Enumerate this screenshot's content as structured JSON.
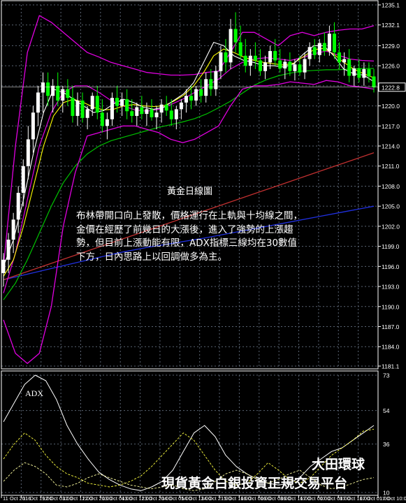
{
  "annotation": {
    "title": "黃金日線圖",
    "lines": [
      "布林帶開口向上發散，價格運行在上軌與十均線之間，",
      "金價在經歷了前幾日的大漲後，進入了強勢的上漲趨",
      "勢，但目前上漲動能有限，ADX指標三線均在30數值",
      "下方，日內思路上以回調做多為主。"
    ]
  },
  "branding": {
    "line1": "大田環球",
    "line2": "現貨黃金白銀投資正規交易平台"
  },
  "colors": {
    "background": "#000000",
    "axis": "#ffffff",
    "grid": "#5a6473",
    "bull_candle": "#ffffff",
    "bear_candle": "#00ff00",
    "bollinger": "#e000e0",
    "ma_fast": "#ffffff",
    "ma_yellow": "#ffff00",
    "ma_green": "#00c000",
    "ma_red": "#c03030",
    "ma_blue": "#2030e0",
    "price_marker": "#ffffff"
  },
  "chart_data": [
    {
      "type": "candlestick",
      "yaxis_side": "right",
      "ylim": [
        1181.1,
        1235.1
      ],
      "yticks": [
        1235.1,
        1232.1,
        1229.0,
        1226.0,
        1223.0,
        1220.0,
        1217.0,
        1214.0,
        1211.0,
        1208.0,
        1205.0,
        1202.0,
        1199.0,
        1196.0,
        1193.0,
        1190.0,
        1187.0,
        1184.0,
        1181.1
      ],
      "ytick_labels": [
        "1235.1",
        "1232.1",
        "1229.0",
        "1226.0",
        "1223.0",
        "1220.0",
        "1217.0",
        "1214.0",
        "1211.0",
        "1208.0",
        "1205.0",
        "1202.0",
        "1199.0",
        "1196.0",
        "1193.0",
        "1190.0",
        "1187.0",
        "1184.0",
        "1181.1"
      ],
      "current_price": 1222.8,
      "current_price_label": "1222.8",
      "xtick_labels": [
        "11 Oct 2016",
        "11 Oct 19:00",
        "12 Oct 03:00",
        "12 Oct 12:00",
        "12 Oct 20:00",
        "13 Oct 04:00",
        "13 Oct 12:00",
        "13 Oct 20:00",
        "14 Oct 05:00",
        "14 Oct 13:00",
        "14 Oct 21:00",
        "15 Oct 16:00",
        "16 Oct 00:00",
        "16 Oct 08:00",
        "16 Oct 16:00",
        "17 Oct 00:00",
        "17 Oct 08:00",
        "17 Oct 16:00",
        "17 Oct 01:00",
        "17 Oct 10:00"
      ],
      "candles": [
        {
          "o": 1195.0,
          "h": 1198.0,
          "l": 1193.0,
          "c": 1197.0
        },
        {
          "o": 1197.0,
          "h": 1201.0,
          "l": 1195.0,
          "c": 1200.0
        },
        {
          "o": 1200.0,
          "h": 1204.0,
          "l": 1198.0,
          "c": 1203.0
        },
        {
          "o": 1203.0,
          "h": 1208.0,
          "l": 1201.0,
          "c": 1207.0
        },
        {
          "o": 1207.0,
          "h": 1212.0,
          "l": 1205.0,
          "c": 1211.0
        },
        {
          "o": 1211.0,
          "h": 1217.0,
          "l": 1209.0,
          "c": 1215.0
        },
        {
          "o": 1215.0,
          "h": 1220.0,
          "l": 1213.0,
          "c": 1219.0
        },
        {
          "o": 1219.0,
          "h": 1223.0,
          "l": 1217.0,
          "c": 1222.0
        },
        {
          "o": 1222.0,
          "h": 1225.0,
          "l": 1219.0,
          "c": 1223.5
        },
        {
          "o": 1223.5,
          "h": 1225.0,
          "l": 1220.0,
          "c": 1221.5
        },
        {
          "o": 1221.5,
          "h": 1224.0,
          "l": 1219.0,
          "c": 1223.0
        },
        {
          "o": 1223.0,
          "h": 1225.0,
          "l": 1220.0,
          "c": 1220.8
        },
        {
          "o": 1220.8,
          "h": 1223.0,
          "l": 1219.0,
          "c": 1222.5
        },
        {
          "o": 1222.5,
          "h": 1224.0,
          "l": 1220.0,
          "c": 1221.2
        },
        {
          "o": 1221.2,
          "h": 1223.0,
          "l": 1217.5,
          "c": 1218.5
        },
        {
          "o": 1218.5,
          "h": 1222.0,
          "l": 1217.0,
          "c": 1220.8
        },
        {
          "o": 1220.8,
          "h": 1222.0,
          "l": 1217.5,
          "c": 1218.2
        },
        {
          "o": 1218.2,
          "h": 1220.0,
          "l": 1216.5,
          "c": 1219.5
        },
        {
          "o": 1219.5,
          "h": 1222.0,
          "l": 1218.5,
          "c": 1221.5
        },
        {
          "o": 1221.5,
          "h": 1223.0,
          "l": 1218.0,
          "c": 1219.0
        },
        {
          "o": 1219.0,
          "h": 1221.0,
          "l": 1216.0,
          "c": 1217.0
        },
        {
          "o": 1217.0,
          "h": 1219.0,
          "l": 1215.0,
          "c": 1218.0
        },
        {
          "o": 1218.0,
          "h": 1222.0,
          "l": 1217.0,
          "c": 1221.2
        },
        {
          "o": 1221.2,
          "h": 1223.0,
          "l": 1219.0,
          "c": 1220.0
        },
        {
          "o": 1220.0,
          "h": 1222.0,
          "l": 1218.5,
          "c": 1221.0
        },
        {
          "o": 1221.0,
          "h": 1222.5,
          "l": 1218.0,
          "c": 1219.2
        },
        {
          "o": 1219.2,
          "h": 1221.0,
          "l": 1217.5,
          "c": 1218.5
        },
        {
          "o": 1218.5,
          "h": 1220.5,
          "l": 1217.0,
          "c": 1219.8
        },
        {
          "o": 1219.8,
          "h": 1221.5,
          "l": 1218.0,
          "c": 1218.8
        },
        {
          "o": 1218.8,
          "h": 1220.5,
          "l": 1217.0,
          "c": 1219.5
        },
        {
          "o": 1219.5,
          "h": 1221.0,
          "l": 1217.8,
          "c": 1218.3
        },
        {
          "o": 1218.3,
          "h": 1220.0,
          "l": 1216.5,
          "c": 1219.0
        },
        {
          "o": 1219.0,
          "h": 1221.0,
          "l": 1217.5,
          "c": 1220.2
        },
        {
          "o": 1220.2,
          "h": 1221.5,
          "l": 1218.5,
          "c": 1219.3
        },
        {
          "o": 1219.3,
          "h": 1221.0,
          "l": 1217.0,
          "c": 1218.0
        },
        {
          "o": 1218.0,
          "h": 1220.0,
          "l": 1216.5,
          "c": 1219.5
        },
        {
          "o": 1219.5,
          "h": 1221.0,
          "l": 1218.0,
          "c": 1220.5
        },
        {
          "o": 1220.5,
          "h": 1222.5,
          "l": 1219.0,
          "c": 1221.5
        },
        {
          "o": 1221.5,
          "h": 1223.0,
          "l": 1219.5,
          "c": 1220.8
        },
        {
          "o": 1220.8,
          "h": 1223.0,
          "l": 1220.0,
          "c": 1222.5
        },
        {
          "o": 1222.5,
          "h": 1224.0,
          "l": 1220.5,
          "c": 1221.5
        },
        {
          "o": 1221.5,
          "h": 1225.0,
          "l": 1220.5,
          "c": 1224.0
        },
        {
          "o": 1224.0,
          "h": 1225.5,
          "l": 1221.5,
          "c": 1222.5
        },
        {
          "o": 1222.5,
          "h": 1226.0,
          "l": 1221.5,
          "c": 1225.2
        },
        {
          "o": 1225.2,
          "h": 1229.0,
          "l": 1224.0,
          "c": 1228.0
        },
        {
          "o": 1228.0,
          "h": 1230.0,
          "l": 1225.0,
          "c": 1226.5
        },
        {
          "o": 1226.5,
          "h": 1233.0,
          "l": 1225.5,
          "c": 1231.5
        },
        {
          "o": 1231.5,
          "h": 1234.0,
          "l": 1228.0,
          "c": 1229.5
        },
        {
          "o": 1229.5,
          "h": 1232.0,
          "l": 1227.0,
          "c": 1227.5
        },
        {
          "o": 1227.5,
          "h": 1230.0,
          "l": 1225.0,
          "c": 1226.0
        },
        {
          "o": 1226.0,
          "h": 1228.5,
          "l": 1224.5,
          "c": 1227.5
        },
        {
          "o": 1227.5,
          "h": 1229.5,
          "l": 1225.5,
          "c": 1226.8
        },
        {
          "o": 1226.8,
          "h": 1228.5,
          "l": 1224.5,
          "c": 1225.2
        },
        {
          "o": 1225.2,
          "h": 1227.5,
          "l": 1224.0,
          "c": 1226.5
        },
        {
          "o": 1226.5,
          "h": 1229.0,
          "l": 1225.5,
          "c": 1228.2
        },
        {
          "o": 1228.2,
          "h": 1230.0,
          "l": 1226.0,
          "c": 1226.8
        },
        {
          "o": 1226.8,
          "h": 1228.5,
          "l": 1225.0,
          "c": 1225.6
        },
        {
          "o": 1225.6,
          "h": 1227.0,
          "l": 1224.0,
          "c": 1226.6
        },
        {
          "o": 1226.6,
          "h": 1228.0,
          "l": 1224.5,
          "c": 1225.2
        },
        {
          "o": 1225.2,
          "h": 1227.0,
          "l": 1223.8,
          "c": 1226.2
        },
        {
          "o": 1226.2,
          "h": 1227.5,
          "l": 1224.5,
          "c": 1225.0
        },
        {
          "o": 1225.0,
          "h": 1228.0,
          "l": 1224.0,
          "c": 1227.0
        },
        {
          "o": 1227.0,
          "h": 1229.5,
          "l": 1226.0,
          "c": 1228.8
        },
        {
          "o": 1228.8,
          "h": 1230.0,
          "l": 1227.0,
          "c": 1227.6
        },
        {
          "o": 1227.6,
          "h": 1230.0,
          "l": 1226.5,
          "c": 1229.4
        },
        {
          "o": 1229.4,
          "h": 1231.0,
          "l": 1227.5,
          "c": 1228.2
        },
        {
          "o": 1228.2,
          "h": 1232.0,
          "l": 1227.5,
          "c": 1230.8
        },
        {
          "o": 1230.8,
          "h": 1232.5,
          "l": 1227.0,
          "c": 1228.0
        },
        {
          "o": 1228.0,
          "h": 1229.5,
          "l": 1225.5,
          "c": 1226.5
        },
        {
          "o": 1226.5,
          "h": 1228.0,
          "l": 1224.5,
          "c": 1227.0
        },
        {
          "o": 1227.0,
          "h": 1228.5,
          "l": 1223.5,
          "c": 1224.5
        },
        {
          "o": 1224.5,
          "h": 1226.0,
          "l": 1223.0,
          "c": 1225.6
        },
        {
          "o": 1225.6,
          "h": 1227.0,
          "l": 1223.5,
          "c": 1224.2
        },
        {
          "o": 1224.2,
          "h": 1226.5,
          "l": 1223.0,
          "c": 1225.5
        },
        {
          "o": 1225.5,
          "h": 1226.5,
          "l": 1223.5,
          "c": 1224.4
        },
        {
          "o": 1224.4,
          "h": 1225.5,
          "l": 1222.0,
          "c": 1222.8
        }
      ],
      "series": [
        {
          "id": "bb_upper",
          "kind": "line",
          "y": [
            1196.0,
            1214.0,
            1228.0,
            1233.5,
            1232.5,
            1231.0,
            1229.5,
            1228.0,
            1227.3,
            1226.5,
            1226.0,
            1225.5,
            1225.0,
            1224.8,
            1224.6,
            1224.6,
            1224.7,
            1225.0,
            1225.2,
            1228.0,
            1231.0,
            1231.0,
            1230.0,
            1229.0,
            1230.5,
            1231.0,
            1230.5,
            1231.0,
            1231.3,
            1231.5,
            1231.5,
            1232.0
          ]
        },
        {
          "id": "bb_mid",
          "kind": "line",
          "y": [
            1192.0,
            1198.0,
            1206.0,
            1214.0,
            1219.0,
            1222.0,
            1223.0,
            1223.0,
            1222.0,
            1220.8,
            1220.0,
            1219.4,
            1219.2,
            1219.5,
            1220.2,
            1221.0,
            1222.0,
            1223.0,
            1224.0,
            1225.5,
            1226.5,
            1227.0,
            1227.2,
            1227.0,
            1226.8,
            1227.2,
            1227.8,
            1228.2,
            1227.6,
            1227.0,
            1226.8,
            1226.7
          ]
        },
        {
          "id": "bb_lower",
          "kind": "line",
          "y": [
            1188.0,
            1183.0,
            1181.5,
            1183.0,
            1190.0,
            1202.0,
            1210.0,
            1215.5,
            1216.0,
            1216.5,
            1217.0,
            1217.0,
            1216.5,
            1216.0,
            1215.0,
            1214.5,
            1215.0,
            1216.0,
            1217.0,
            1220.0,
            1222.5,
            1223.0,
            1223.0,
            1223.2,
            1223.6,
            1223.4,
            1223.2,
            1223.8,
            1223.6,
            1223.0,
            1222.8,
            1222.5
          ]
        },
        {
          "id": "ma_fast",
          "kind": "line",
          "y": [
            1196.0,
            1200.0,
            1206.0,
            1213.0,
            1219.0,
            1222.5,
            1222.0,
            1221.0,
            1220.0,
            1219.0,
            1219.3,
            1220.3,
            1221.0,
            1220.5,
            1219.8,
            1219.5,
            1219.8,
            1220.8,
            1221.8,
            1223.5,
            1226.5,
            1229.5,
            1229.0,
            1227.5,
            1226.8,
            1226.5,
            1226.0,
            1226.0,
            1225.8,
            1226.3,
            1227.8,
            1229.0,
            1229.0,
            1227.5,
            1225.5,
            1224.8,
            1224.6,
            1223.6
          ]
        },
        {
          "id": "ma_yellow",
          "kind": "line",
          "y": [
            1194.5,
            1197.0,
            1202.0,
            1208.0,
            1214.0,
            1218.5,
            1220.5,
            1221.0,
            1220.5,
            1219.8,
            1219.4,
            1219.5,
            1220.0,
            1220.2,
            1220.0,
            1219.9,
            1220.0,
            1220.7,
            1221.6,
            1223.0,
            1225.0,
            1227.5,
            1228.5,
            1228.0,
            1227.3,
            1226.8,
            1226.5,
            1226.3,
            1226.1,
            1226.4,
            1227.4,
            1228.4,
            1228.6,
            1227.7,
            1226.5,
            1225.5,
            1224.8,
            1224.2
          ]
        },
        {
          "id": "ma_green",
          "kind": "line",
          "y": [
            1191.0,
            1193.5,
            1197.0,
            1201.0,
            1205.0,
            1208.5,
            1211.0,
            1212.8,
            1214.0,
            1214.8,
            1215.3,
            1215.8,
            1216.3,
            1216.8,
            1217.2,
            1217.6,
            1218.1,
            1218.8,
            1219.7,
            1220.7,
            1221.9,
            1223.1,
            1223.9,
            1224.5,
            1224.9,
            1225.2,
            1225.3,
            1225.4,
            1225.4,
            1225.5,
            1225.6,
            1225.6
          ]
        },
        {
          "id": "ma_red",
          "kind": "line",
          "y": [
            1194.0,
            1195.0,
            1196.0,
            1197.0,
            1198.0,
            1199.0,
            1200.0,
            1201.0,
            1202.0,
            1203.0,
            1204.0,
            1205.0,
            1206.0,
            1207.0,
            1208.0,
            1209.0,
            1210.0,
            1211.0,
            1212.0,
            1213.0
          ]
        },
        {
          "id": "ma_blue",
          "kind": "line",
          "y": [
            1194.0,
            1195.0,
            1196.0,
            1197.0,
            1198.0,
            1198.8,
            1199.5,
            1200.2,
            1201.0,
            1201.8,
            1202.6,
            1203.4,
            1204.2,
            1205.0
          ]
        }
      ]
    },
    {
      "type": "line",
      "indicator": "ADX",
      "yaxis_side": "right",
      "ylim": [
        10,
        73
      ],
      "yticks": [
        73,
        54,
        36,
        10
      ],
      "ytick_labels": [
        "73",
        "54",
        "36",
        "10"
      ],
      "series": [
        {
          "name": "ADX",
          "style": "solid",
          "y": [
            48,
            58,
            68,
            73,
            70,
            60,
            46,
            36,
            28,
            21,
            17,
            14,
            12,
            11,
            13,
            16,
            22,
            32,
            42,
            46,
            40,
            30,
            24,
            20,
            17,
            15,
            14,
            15,
            18,
            24,
            28,
            32,
            34,
            38,
            42,
            46
          ]
        },
        {
          "id": "plus_di",
          "style": "dashed",
          "y": [
            28,
            36,
            42,
            38,
            30,
            24,
            20,
            18,
            15,
            14,
            13,
            14,
            16,
            19,
            24,
            30,
            36,
            42,
            38,
            30,
            22,
            16,
            14,
            15,
            20,
            26,
            22,
            17,
            15,
            18,
            24,
            30,
            34,
            38,
            43,
            44
          ]
        },
        {
          "id": "minus_di",
          "style": "dashed",
          "y": [
            16,
            22,
            26,
            24,
            20,
            14,
            13,
            15,
            18,
            20,
            18,
            16,
            14,
            13,
            12,
            13,
            14,
            12,
            11,
            12,
            16,
            20,
            22,
            20,
            17,
            15,
            17,
            20,
            22,
            18,
            14,
            12,
            13,
            15,
            17,
            18
          ]
        }
      ]
    }
  ]
}
